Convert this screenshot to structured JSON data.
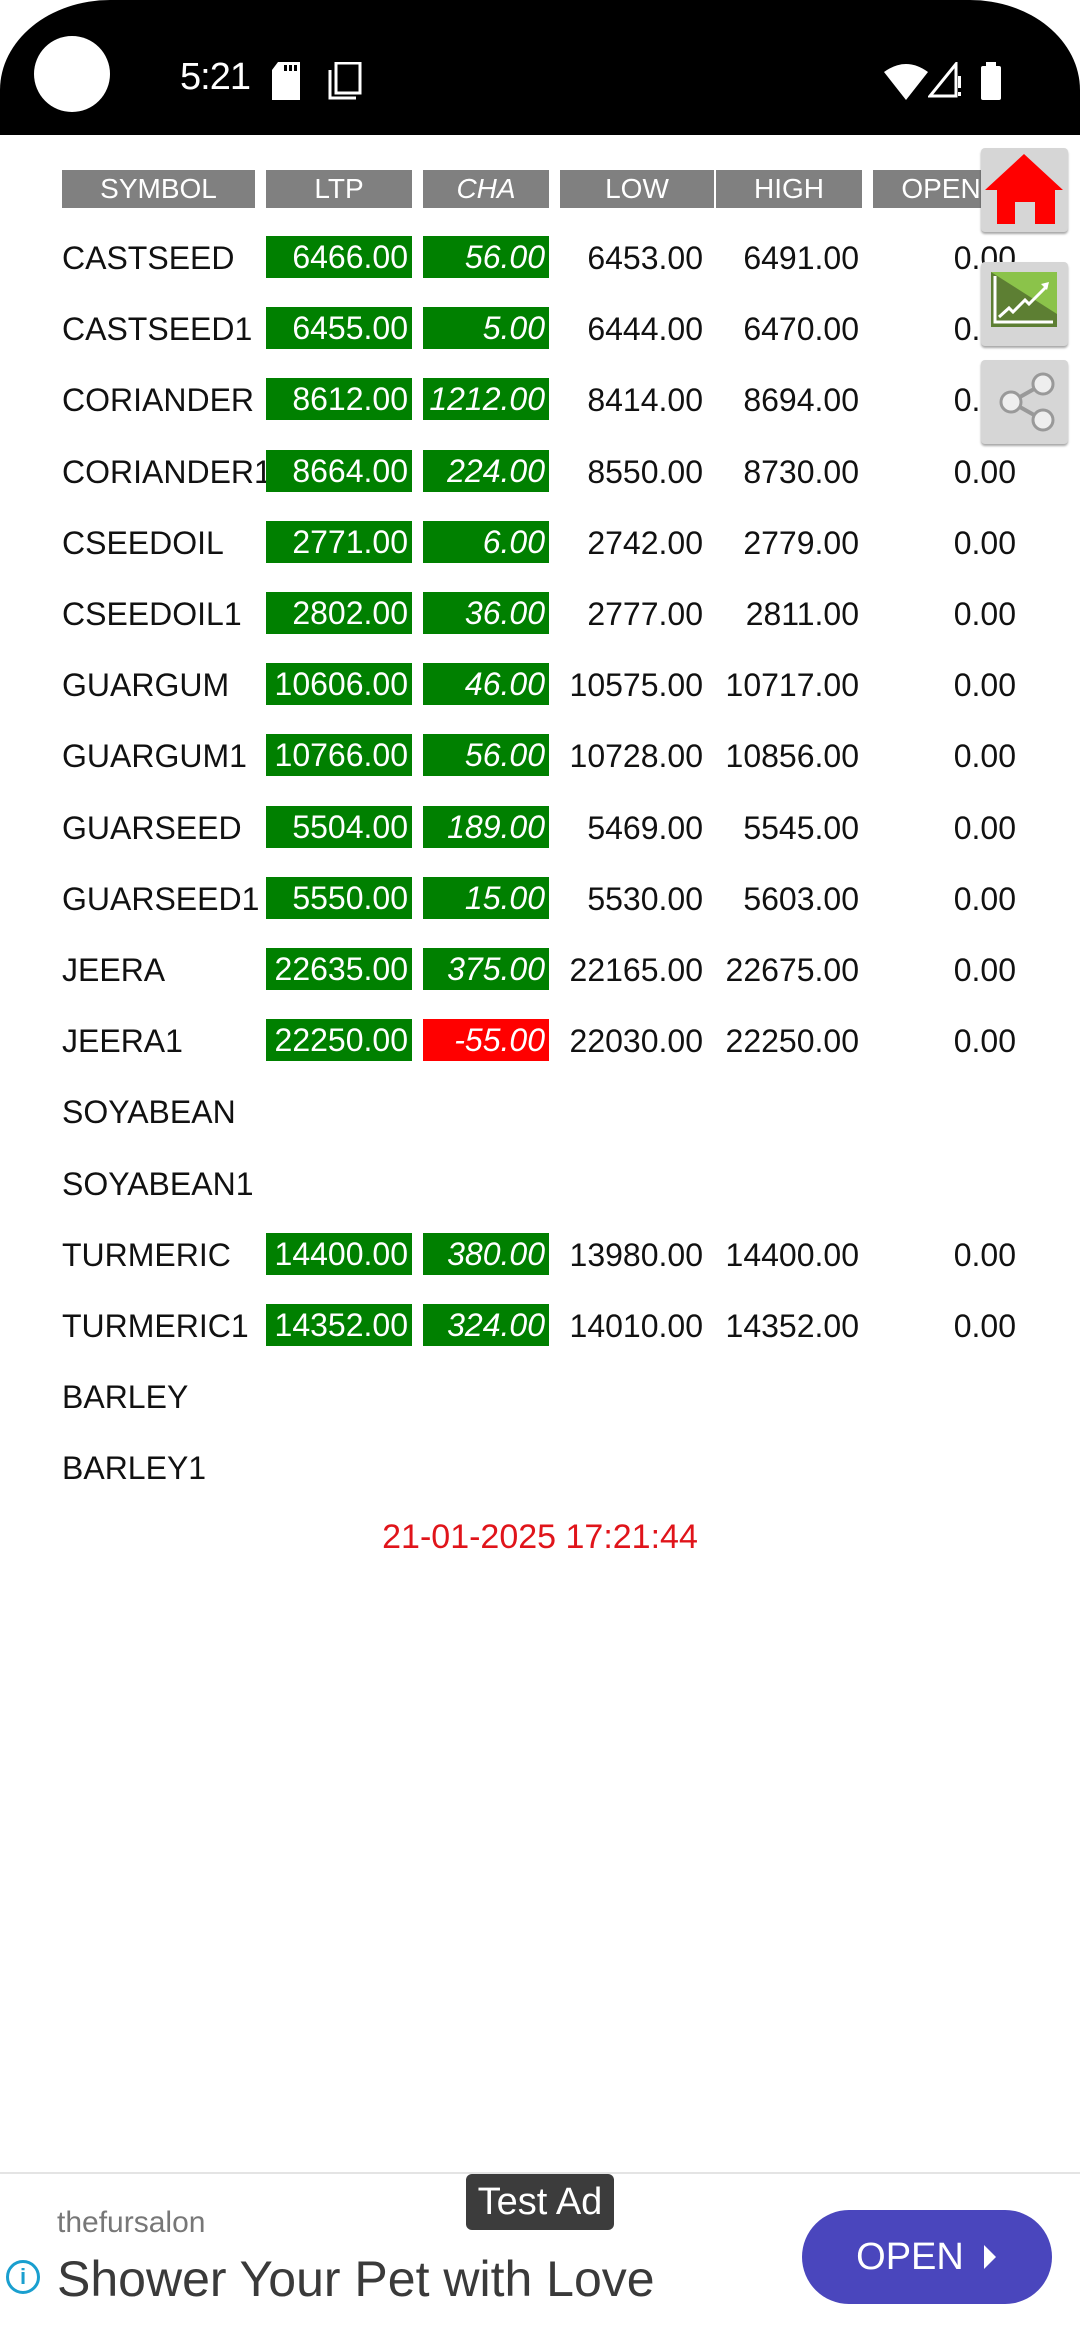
{
  "status_bar": {
    "time": "5:21",
    "left_icons": [
      "sd-card-icon",
      "screenshot-icon"
    ],
    "right_icons": [
      "wifi-icon",
      "signal-icon",
      "battery-icon"
    ]
  },
  "table": {
    "headers": [
      "SYMBOL",
      "LTP",
      "CHA",
      "LOW",
      "HIGH",
      "OPEN"
    ],
    "rows": [
      {
        "symbol": "CASTSEED",
        "ltp": "6466.00",
        "cha": "56.00",
        "low": "6453.00",
        "high": "6491.00",
        "open": "0.00",
        "trend": "up"
      },
      {
        "symbol": "CASTSEED1",
        "ltp": "6455.00",
        "cha": "5.00",
        "low": "6444.00",
        "high": "6470.00",
        "open": "0.00",
        "trend": "up"
      },
      {
        "symbol": "CORIANDER",
        "ltp": "8612.00",
        "cha": "1212.00",
        "low": "8414.00",
        "high": "8694.00",
        "open": "0.00",
        "trend": "up"
      },
      {
        "symbol": "CORIANDER1",
        "ltp": "8664.00",
        "cha": "224.00",
        "low": "8550.00",
        "high": "8730.00",
        "open": "0.00",
        "trend": "up"
      },
      {
        "symbol": "CSEEDOIL",
        "ltp": "2771.00",
        "cha": "6.00",
        "low": "2742.00",
        "high": "2779.00",
        "open": "0.00",
        "trend": "up"
      },
      {
        "symbol": "CSEEDOIL1",
        "ltp": "2802.00",
        "cha": "36.00",
        "low": "2777.00",
        "high": "2811.00",
        "open": "0.00",
        "trend": "up"
      },
      {
        "symbol": "GUARGUM",
        "ltp": "10606.00",
        "cha": "46.00",
        "low": "10575.00",
        "high": "10717.00",
        "open": "0.00",
        "trend": "up"
      },
      {
        "symbol": "GUARGUM1",
        "ltp": "10766.00",
        "cha": "56.00",
        "low": "10728.00",
        "high": "10856.00",
        "open": "0.00",
        "trend": "up"
      },
      {
        "symbol": "GUARSEED",
        "ltp": "5504.00",
        "cha": "189.00",
        "low": "5469.00",
        "high": "5545.00",
        "open": "0.00",
        "trend": "up"
      },
      {
        "symbol": "GUARSEED1",
        "ltp": "5550.00",
        "cha": "15.00",
        "low": "5530.00",
        "high": "5603.00",
        "open": "0.00",
        "trend": "up"
      },
      {
        "symbol": "JEERA",
        "ltp": "22635.00",
        "cha": "375.00",
        "low": "22165.00",
        "high": "22675.00",
        "open": "0.00",
        "trend": "up"
      },
      {
        "symbol": "JEERA1",
        "ltp": "22250.00",
        "cha": "-55.00",
        "low": "22030.00",
        "high": "22250.00",
        "open": "0.00",
        "trend": "down"
      },
      {
        "symbol": "SOYABEAN",
        "ltp": "",
        "cha": "",
        "low": "",
        "high": "",
        "open": "",
        "trend": "none"
      },
      {
        "symbol": "SOYABEAN1",
        "ltp": "",
        "cha": "",
        "low": "",
        "high": "",
        "open": "",
        "trend": "none"
      },
      {
        "symbol": "TURMERIC",
        "ltp": "14400.00",
        "cha": "380.00",
        "low": "13980.00",
        "high": "14400.00",
        "open": "0.00",
        "trend": "up"
      },
      {
        "symbol": "TURMERIC1",
        "ltp": "14352.00",
        "cha": "324.00",
        "low": "14010.00",
        "high": "14352.00",
        "open": "0.00",
        "trend": "up"
      },
      {
        "symbol": "BARLEY",
        "ltp": "",
        "cha": "",
        "low": "",
        "high": "",
        "open": "",
        "trend": "none"
      },
      {
        "symbol": "BARLEY1",
        "ltp": "",
        "cha": "",
        "low": "",
        "high": "",
        "open": "",
        "trend": "none"
      }
    ]
  },
  "timestamp": "21-01-2025 17:21:44",
  "floating_buttons": [
    "home-icon",
    "chart-icon",
    "share-icon"
  ],
  "colors": {
    "up": "#008000",
    "down": "#ff0000",
    "header_bg": "#808080",
    "timestamp": "#e0141a",
    "ad_button": "#4a46bd"
  },
  "ad": {
    "badge": "Test Ad",
    "advertiser": "thefursalon",
    "headline": "Shower Your Pet with Love",
    "cta": "OPEN"
  }
}
